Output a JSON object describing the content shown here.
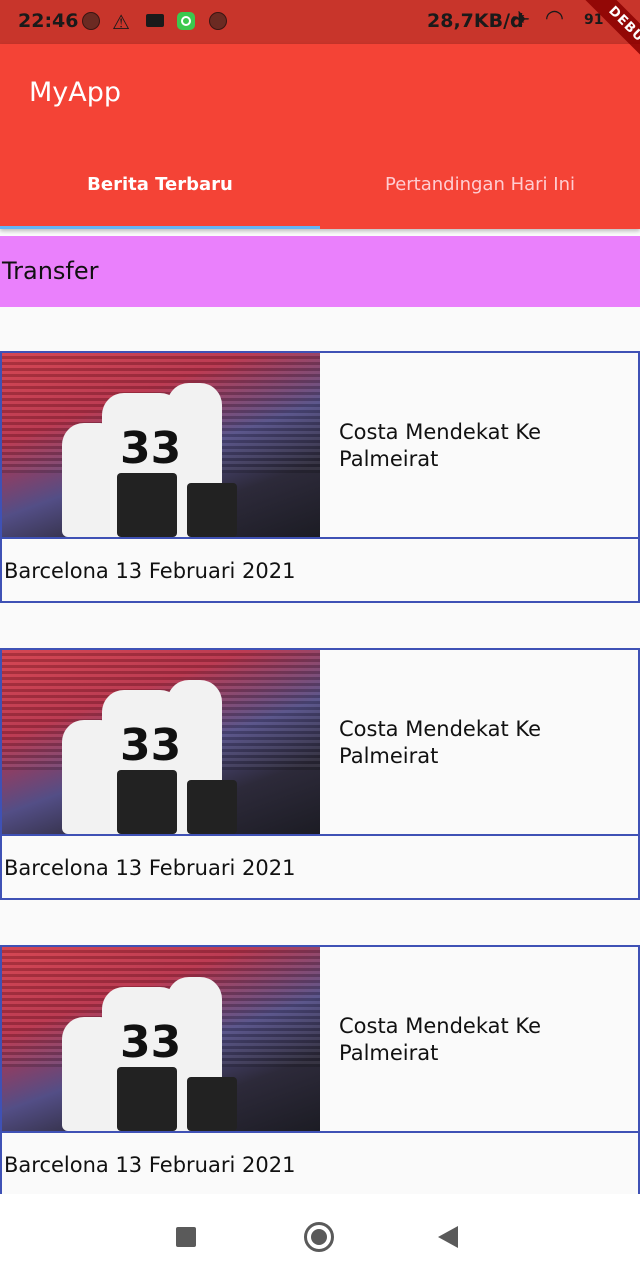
{
  "statusbar": {
    "time": "22:46",
    "network_speed": "28,7KB/d",
    "battery_level": "91"
  },
  "appbar": {
    "title": "MyApp",
    "tabs": [
      {
        "label": "Berita Terbaru",
        "selected": true
      },
      {
        "label": "Pertandingan Hari Ini",
        "selected": false
      }
    ],
    "accent_color": "#f44336",
    "indicator_color": "#64b5f6"
  },
  "debug_banner": "DEBUG",
  "category": {
    "label": "Transfer",
    "color": "#ea80fc"
  },
  "news": [
    {
      "title": "Costa Mendekat Ke Palmeirat",
      "date": "Barcelona 13 Februari 2021",
      "image": "football-players-photo"
    },
    {
      "title": "Costa Mendekat Ke Palmeirat",
      "date": "Barcelona 13 Februari 2021",
      "image": "football-players-photo"
    },
    {
      "title": "Costa Mendekat Ke Palmeirat",
      "date": "Barcelona 13 Februari 2021",
      "image": "football-players-photo"
    }
  ],
  "navbar": {
    "icons": [
      "recents-square-icon",
      "home-circle-icon",
      "back-triangle-icon"
    ]
  }
}
